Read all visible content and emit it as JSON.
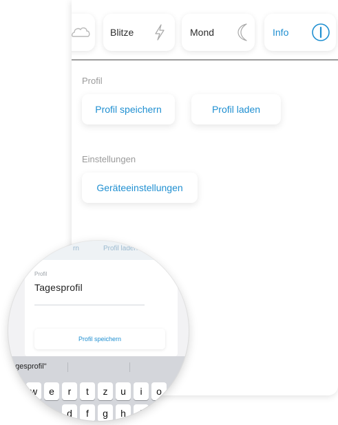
{
  "tabs": [
    {
      "label": "",
      "icon": "cloud-icon"
    },
    {
      "label": "Blitze",
      "icon": "lightning-icon"
    },
    {
      "label": "Mond",
      "icon": "moon-icon"
    },
    {
      "label": "Info",
      "icon": "info-icon"
    }
  ],
  "profile": {
    "title": "Profil",
    "save_label": "Profil speichern",
    "load_label": "Profil laden"
  },
  "settings": {
    "title": "Einstellungen",
    "device_settings_label": "Geräteeinstellungen"
  },
  "magnifier": {
    "ghost_left": "rn",
    "ghost_right": "Profil laden",
    "field_label": "Profil",
    "field_value": "Tagesprofil",
    "save_label": "Profil speichern",
    "suggestion": "agesprofil\"",
    "keys_row1": [
      "w",
      "e",
      "r",
      "t",
      "z",
      "u",
      "i",
      "o"
    ],
    "keys_row2": [
      "d",
      "f",
      "g",
      "h",
      "j"
    ]
  },
  "colors": {
    "accent": "#1f8fd1",
    "text": "#2c2c2c",
    "muted": "#9a9a9a"
  }
}
